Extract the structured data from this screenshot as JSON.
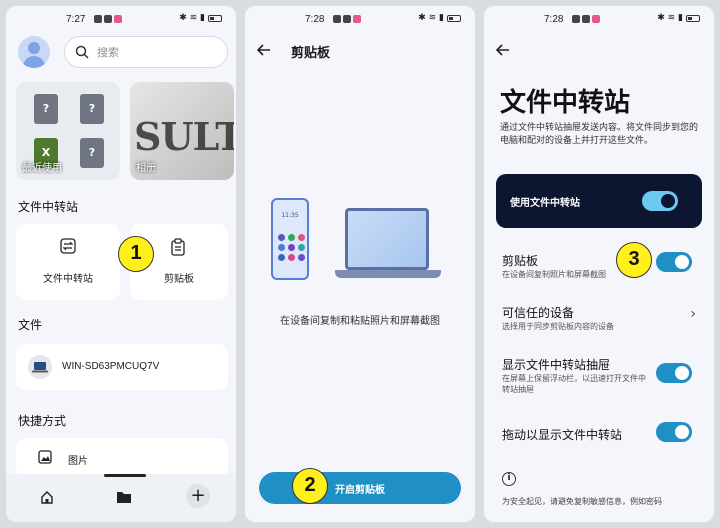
{
  "screens": [
    {
      "status": {
        "time": "7:27"
      },
      "search": {
        "placeholder": "搜索"
      },
      "tiles": {
        "recent": "最近使用",
        "album": "相册",
        "album_text": "SULT"
      },
      "section_transfer": "文件中转站",
      "cards": {
        "transfer": "文件中转站",
        "clipboard": "剪贴板"
      },
      "section_files": "文件",
      "device": "WIN-SD63PMCUQ7V",
      "section_shortcuts": "快捷方式",
      "shortcut": "图片"
    },
    {
      "status": {
        "time": "7:28"
      },
      "title": "剪贴板",
      "phone_time": "11:35",
      "caption": "在设备间复制和粘贴照片和屏幕截图",
      "button": "开启剪贴板"
    },
    {
      "status": {
        "time": "7:28"
      },
      "title": "文件中转站",
      "description": "通过文件中转站抽屉发送内容。将文件同步到您的电脑和配对的设备上并打开这些文件。",
      "master_toggle_label": "使用文件中转站",
      "rows": [
        {
          "title": "剪贴板",
          "subtitle": "在设备间复制照片和屏幕截图",
          "toggle": true
        },
        {
          "title": "可信任的设备",
          "subtitle": "选择用于同步剪贴板内容的设备",
          "chevron": true
        },
        {
          "title": "显示文件中转站抽屉",
          "subtitle": "在屏幕上保留浮动栏，以迅速打开文件中转站抽屉",
          "toggle": true
        },
        {
          "title": "拖动以显示文件中转站",
          "subtitle": "",
          "toggle": true
        }
      ],
      "footer": "为安全起见，请避免复制敏感信息，例如密码"
    }
  ],
  "badges": [
    "1",
    "2",
    "3"
  ],
  "colors": {
    "accent": "#1f8fc6",
    "dark_card": "#0d1630",
    "badge": "#ffef1a"
  }
}
